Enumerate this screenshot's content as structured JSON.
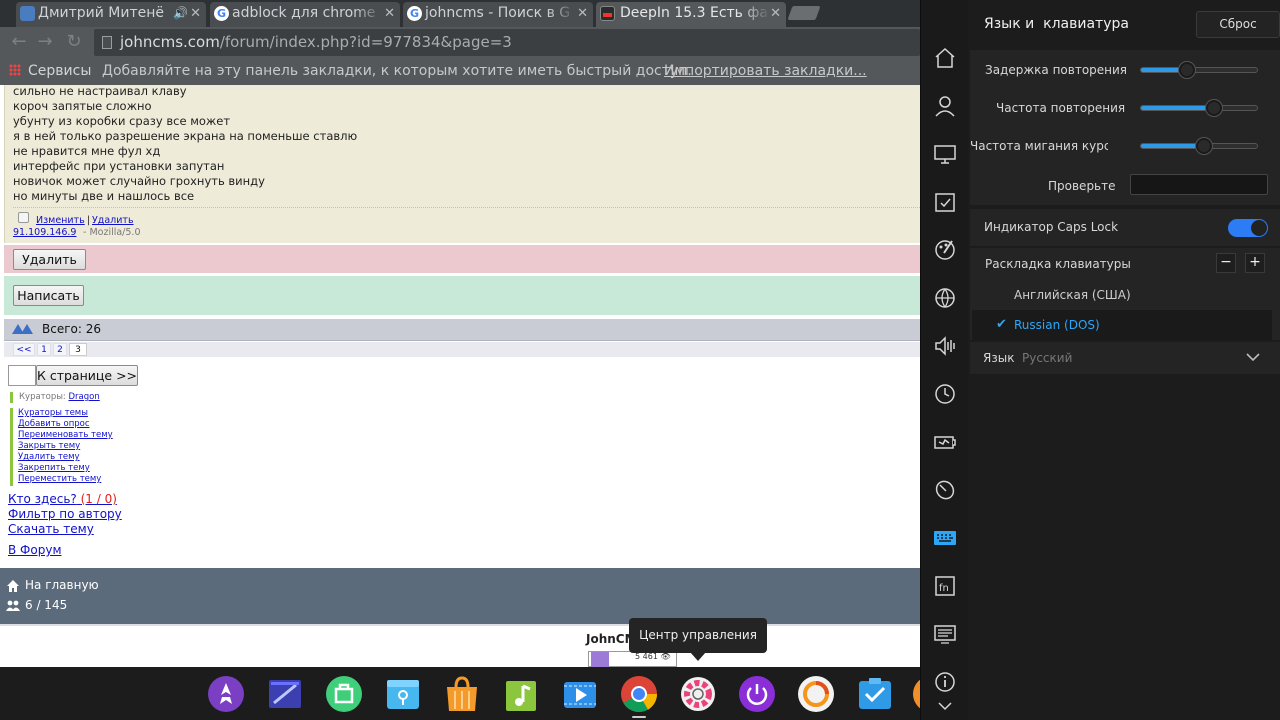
{
  "browser": {
    "tabs": [
      {
        "title": "Дмитрий Митенё",
        "icon": "video-icon",
        "has_audio": true
      },
      {
        "title": "adblock для chrome",
        "icon": "google-icon"
      },
      {
        "title": "johncms - Поиск в G",
        "icon": "google-icon"
      },
      {
        "title": "DeepIn 15.3 Есть фа",
        "icon": "site-icon",
        "active": true
      }
    ],
    "address": {
      "domain": "johncms.com",
      "path": "/forum/index.php?id=977834&page=3"
    },
    "bookmarks": {
      "services": "Сервисы",
      "hint": "Добавляйте на эту панель закладки, к которым хотите иметь быстрый доступ.",
      "import": "Импортировать закладки..."
    }
  },
  "forum": {
    "post_lines": [
      "сильно не настраивал клаву",
      "короч запятые сложно",
      "убунту из коробки сразу все может",
      "я в ней только разрешение экрана на поменьше ставлю",
      "не нравится мне фул хд",
      "интерфейс при установки запутан",
      "новичок может случайно грохнуть винду",
      "но минуты две и нашлось все"
    ],
    "edit": "Изменить",
    "separator": "|",
    "delete_link": "Удалить",
    "ip": "91.109.146.9",
    "user_agent": "- Mozilla/5.0",
    "delete_button": "Удалить",
    "write_button": "Написать",
    "total": "Всего: 26",
    "pages": [
      "<<",
      "1",
      "2",
      "3"
    ],
    "current_page": "3",
    "goto_button": "К странице >>",
    "curators_label": "Кураторы:",
    "curator": "Dragon",
    "mod_links": [
      "Кураторы темы",
      "Добавить опрос",
      "Переименовать тему",
      "Закрыть тему",
      "Удалить тему",
      "Закрепить тему",
      "Переместить тему"
    ],
    "who_here": "Кто здесь?",
    "who_count": "(1 / 0)",
    "filter_author": "Фильтр по автору",
    "download": "Скачать тему",
    "to_forum": "В Форум",
    "home": "На главную",
    "online": "6 / 145",
    "site_name": "JohnCMS",
    "counter": "5 461 👁"
  },
  "dock": {
    "tooltip": "Центр управления",
    "items": [
      "launcher-icon",
      "multitasking-icon",
      "store-icon",
      "file-manager-icon",
      "shopping-icon",
      "music-icon",
      "video-icon",
      "chrome-icon",
      "control-center-icon",
      "shutdown-icon",
      "browser-icon",
      "screenshot-icon"
    ]
  },
  "control_center": {
    "title": "Язык и  клавиатура",
    "reset": "Сброс",
    "repeat_delay": {
      "label": "Задержка повторения",
      "value": 0.4
    },
    "repeat_rate": {
      "label": "Частота повторения",
      "value": 0.63
    },
    "cursor_blink": {
      "label": "Частота мигания курсора",
      "value": 0.54
    },
    "test": {
      "label": "Проверьте",
      "value": ""
    },
    "caps_lock": {
      "label": "Индикатор Caps Lock",
      "on": true
    },
    "layout_header": "Раскладка клавиатуры",
    "layouts": [
      {
        "name": "Английская (США)",
        "selected": false
      },
      {
        "name": "Russian (DOS)",
        "selected": true
      }
    ],
    "language": {
      "label": "Язык",
      "value": "Русский"
    },
    "accent": "#2c9ae6",
    "sidebar_icons": [
      "home-icon",
      "accounts-icon",
      "display-icon",
      "default-apps-icon",
      "personalization-icon",
      "network-icon",
      "sound-icon",
      "time-icon",
      "power-icon",
      "mouse-icon",
      "keyboard-icon",
      "shortcuts-icon",
      "system-info-icon",
      "info-icon",
      "chevron-down-icon"
    ]
  }
}
